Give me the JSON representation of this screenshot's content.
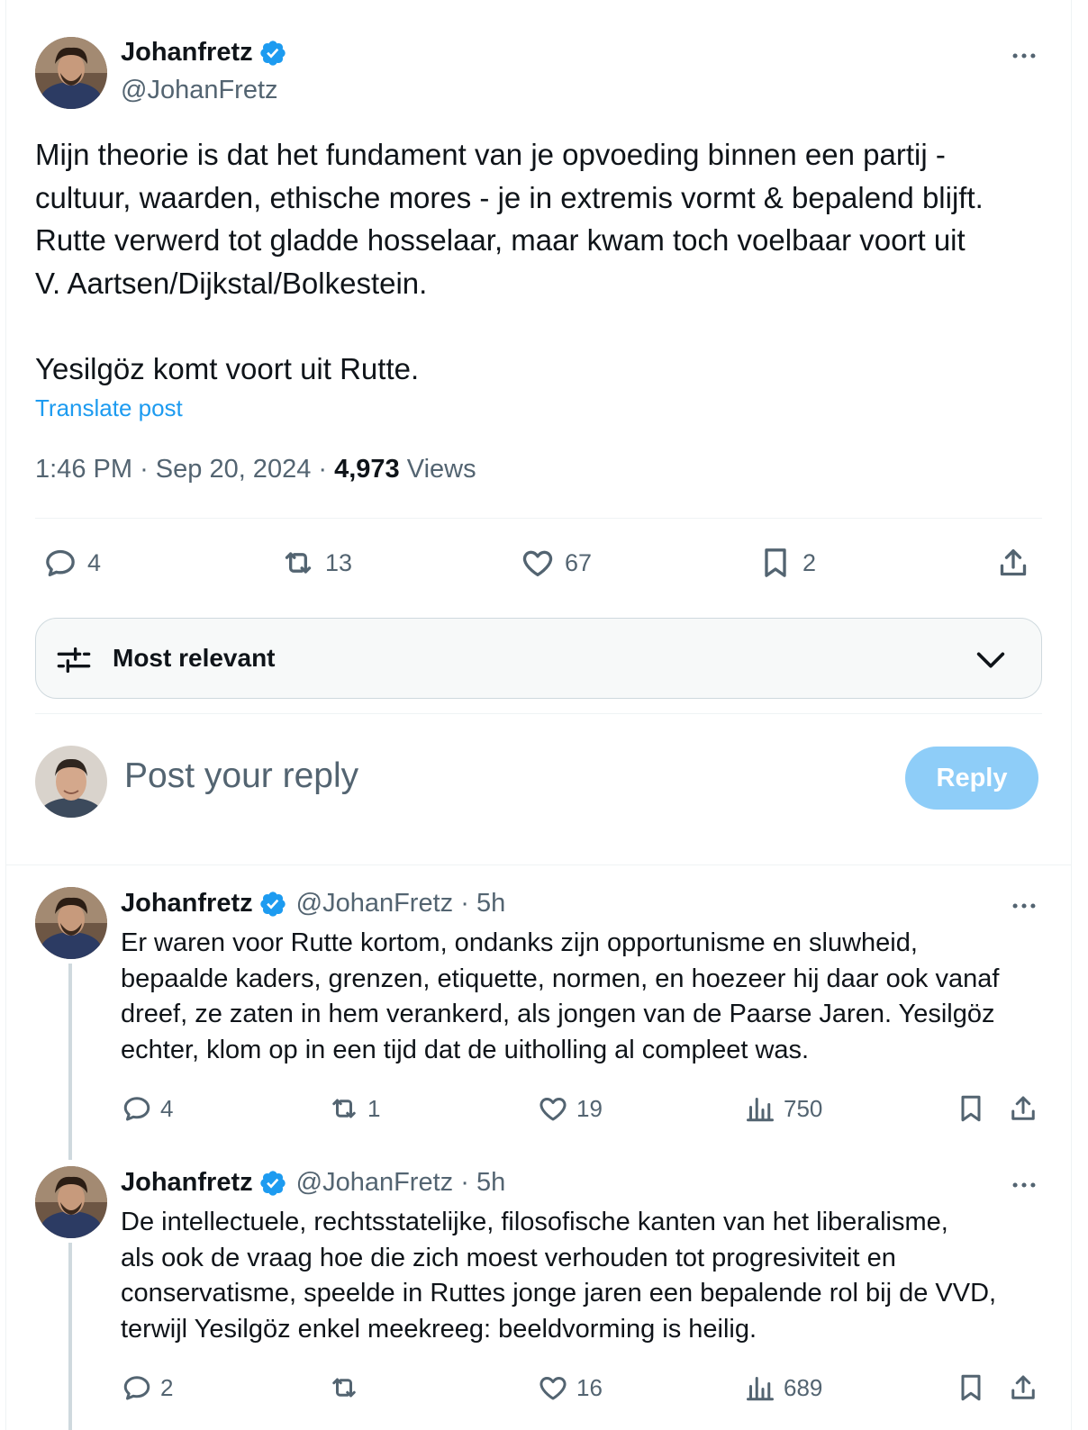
{
  "post": {
    "author_name": "Johanfretz",
    "author_handle": "@JohanFretz",
    "verified_icon": "verified-badge-icon",
    "more_icon": "more-icon",
    "text_lines": [
      "Mijn theorie is dat het fundament van je opvoeding binnen een partij -",
      "cultuur, waarden, ethische mores - je in extremis vormt & bepalend blijft.",
      "Rutte verwerd tot gladde hosselaar, maar kwam toch voelbaar voort uit",
      "V. Aartsen/Dijkstal/Bolkestein.",
      "",
      "Yesilgöz komt voort uit Rutte."
    ],
    "translate_label": "Translate post",
    "time": "1:46 PM",
    "date": "Sep 20, 2024",
    "views_count": "4,973",
    "views_label": "Views",
    "actions": {
      "replies": "4",
      "reposts": "13",
      "likes": "67",
      "bookmarks": "2"
    }
  },
  "sort": {
    "label": "Most relevant",
    "icon": "sliders-icon",
    "chevron": "chevron-down-icon"
  },
  "compose": {
    "placeholder": "Post your reply",
    "button_label": "Reply"
  },
  "replies": [
    {
      "author_name": "Johanfretz",
      "author_handle": "@JohanFretz",
      "age": "5h",
      "text_lines": [
        "Er waren voor Rutte kortom, ondanks zijn opportunisme en sluwheid,",
        "bepaalde kaders, grenzen, etiquette, normen, en hoezeer hij daar ook vanaf",
        "dreef, ze zaten in hem verankerd, als jongen van de Paarse Jaren. Yesilgöz",
        "echter, klom op in een tijd dat de uitholling al compleet was."
      ],
      "replies": "4",
      "reposts": "1",
      "likes": "19",
      "views": "750"
    },
    {
      "author_name": "Johanfretz",
      "author_handle": "@JohanFretz",
      "age": "5h",
      "text_lines": [
        "De intellectuele, rechtsstatelijke, filosofische kanten van het liberalisme,",
        "als ook de vraag hoe die zich moest verhouden tot progresiviteit en",
        "conservatisme, speelde in Ruttes jonge jaren een bepalende rol bij de VVD,",
        "terwijl Yesilgöz enkel meekreeg: beeldvorming is heilig."
      ],
      "replies": "2",
      "reposts": "",
      "likes": "16",
      "views": "689"
    }
  ],
  "colors": {
    "accent": "#1d9bf0",
    "reply_button_disabled": "#8ecdf8",
    "secondary_text": "#536471",
    "primary_text": "#0f1419",
    "divider": "#eff3f4"
  }
}
